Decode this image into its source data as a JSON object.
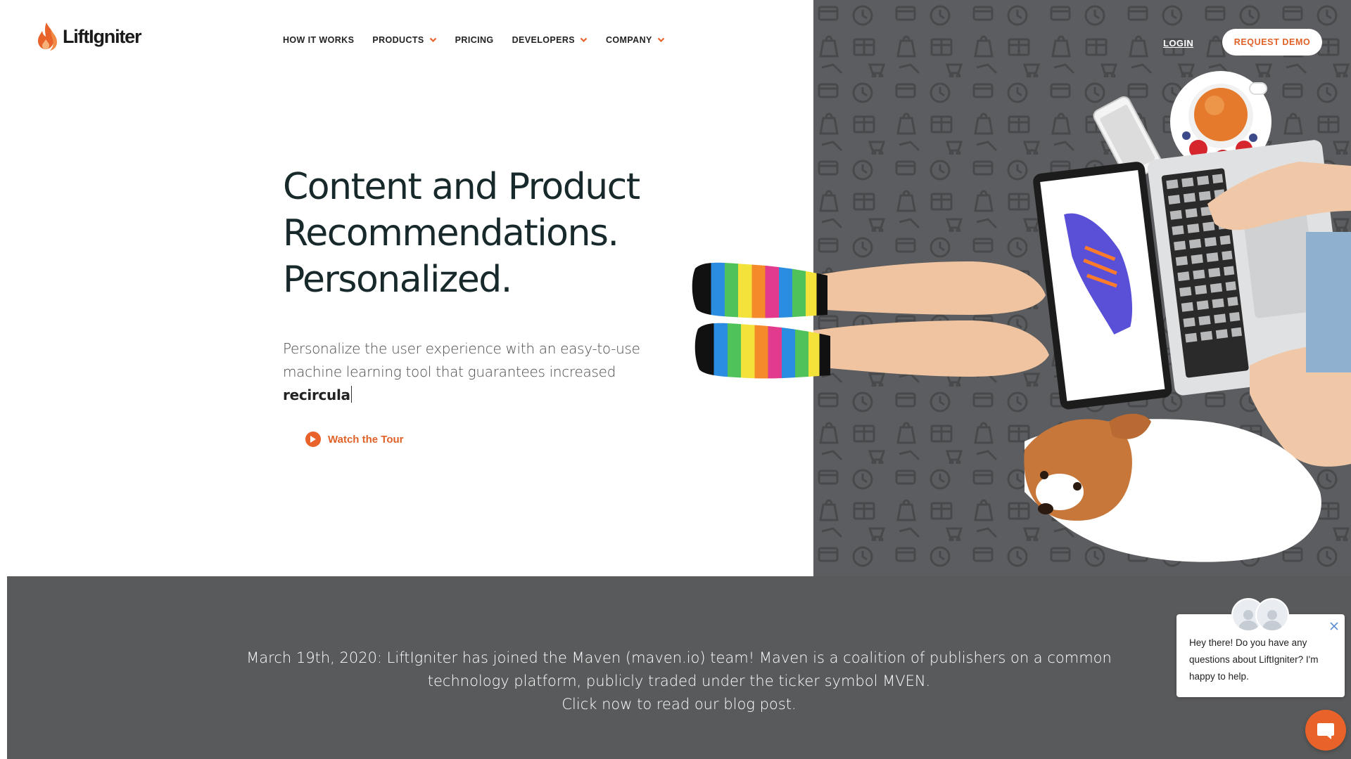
{
  "brand": {
    "name": "LiftIgniter",
    "accent_color": "#e8622a"
  },
  "nav": {
    "items": [
      {
        "label": "HOW IT WORKS",
        "has_dropdown": false
      },
      {
        "label": "PRODUCTS",
        "has_dropdown": true
      },
      {
        "label": "PRICING",
        "has_dropdown": false
      },
      {
        "label": "DEVELOPERS",
        "has_dropdown": true
      },
      {
        "label": "COMPANY",
        "has_dropdown": true
      }
    ],
    "login_label": "LOGIN",
    "demo_label": "REQUEST DEMO"
  },
  "hero": {
    "title_lines": [
      "Content and Product",
      "Recommendations.",
      "Personalized."
    ],
    "subtitle": "Personalize the user experience with an easy-to-use machine learning tool that guarantees increased",
    "typed_word": "recircula",
    "tour_label": "Watch the Tour",
    "tour_icon": "play-icon",
    "image_description_icon": "hero-photo"
  },
  "banner": {
    "lines": [
      "March 19th, 2020: LiftIgniter has joined the Maven (maven.io) team! Maven is a coalition of publishers on a common",
      "technology platform, publicly traded under the ticker symbol MVEN.",
      "Click now to read our blog post."
    ],
    "background_color": "#595a5b"
  },
  "chat": {
    "message": "Hey there! Do you have any questions about LiftIgniter? I'm happy to help.",
    "launcher_icon": "chat-bubble-icon",
    "close_icon": "close-icon"
  }
}
